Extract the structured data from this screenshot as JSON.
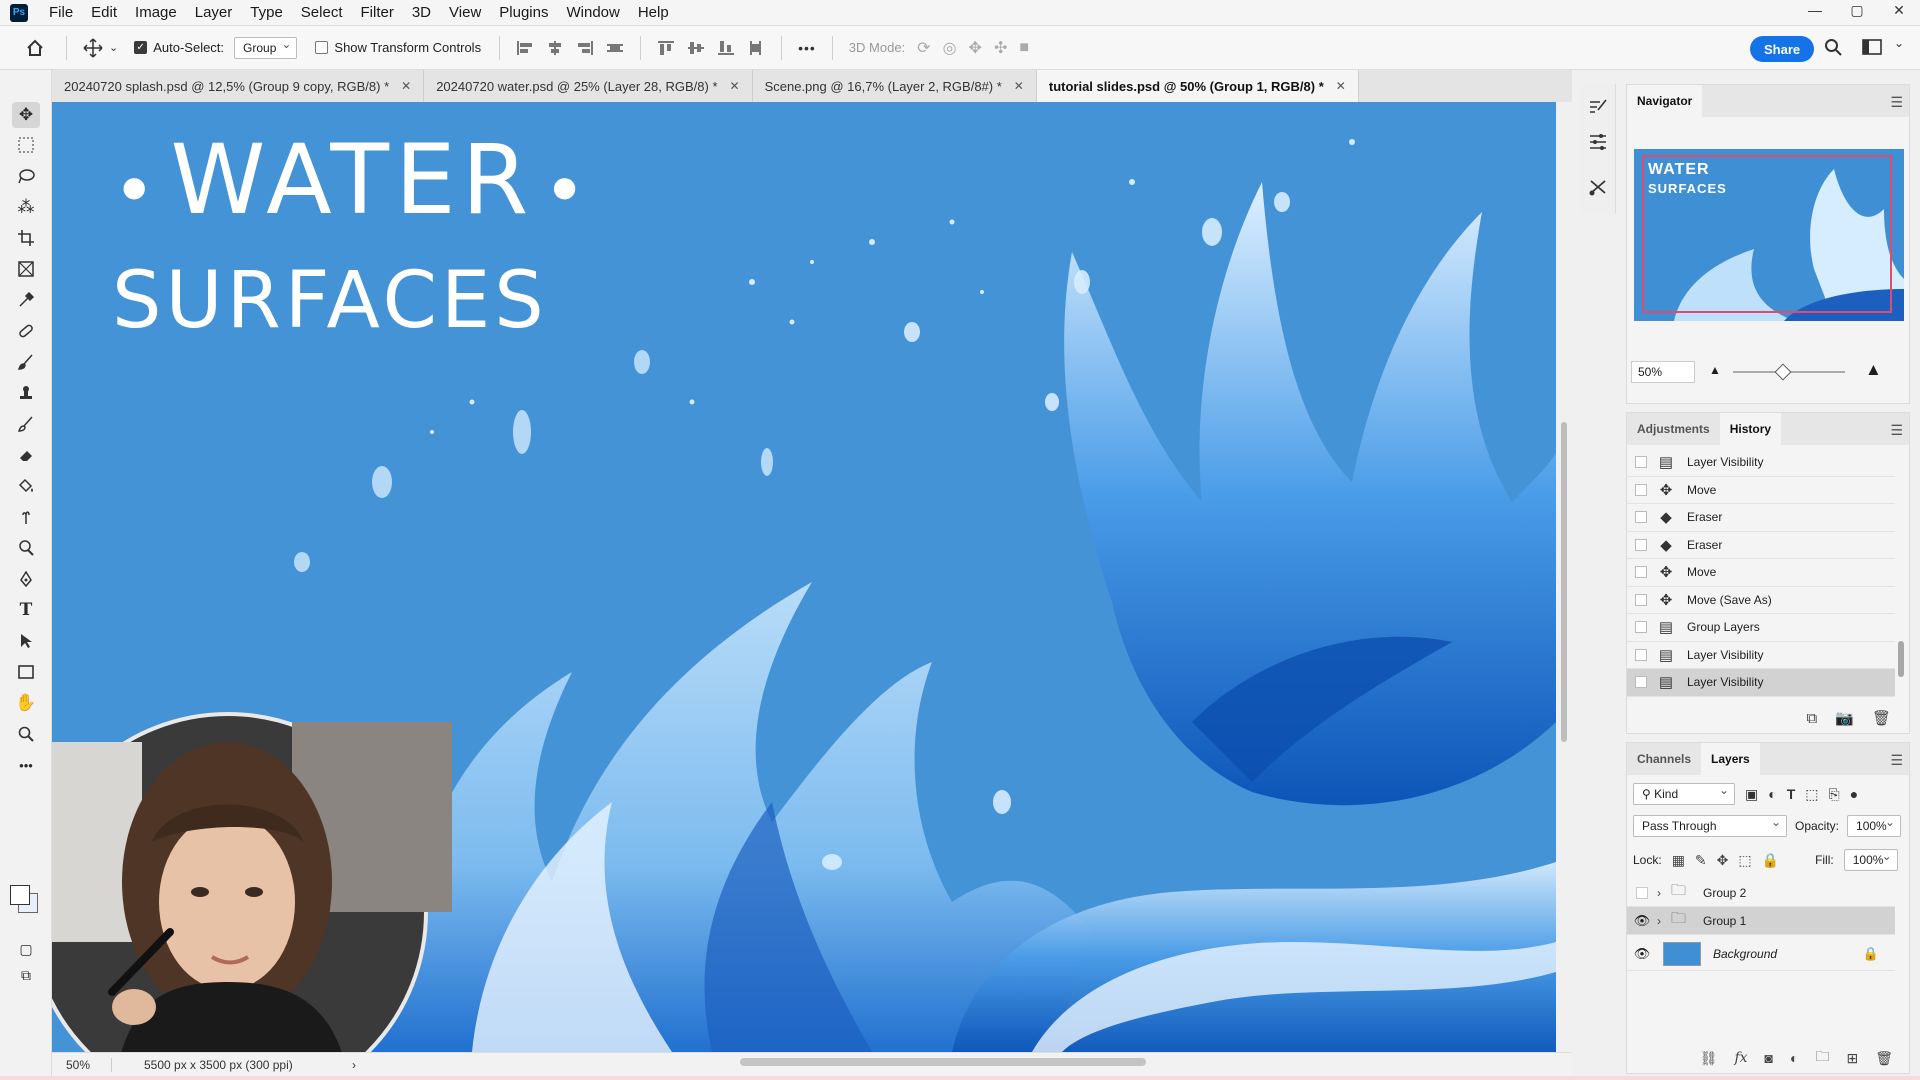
{
  "app": {
    "logo": "Ps"
  },
  "menu": [
    "File",
    "Edit",
    "Image",
    "Layer",
    "Type",
    "Select",
    "Filter",
    "3D",
    "View",
    "Plugins",
    "Window",
    "Help"
  ],
  "window_controls": {
    "minimize": "—",
    "maximize": "▢",
    "close": "✕"
  },
  "options": {
    "auto_select_label": "Auto-Select:",
    "auto_select_checked": true,
    "auto_select_value": "Group",
    "transform_label": "Show Transform Controls",
    "transform_checked": false,
    "more": "•••",
    "mode_label": "3D Mode:",
    "share": "Share"
  },
  "tabs": [
    {
      "label": "20240720 splash.psd @ 12,5% (Group 9 copy, RGB/8) *",
      "close": "✕"
    },
    {
      "label": "20240720 water.psd @ 25% (Layer 28, RGB/8) *",
      "close": "✕"
    },
    {
      "label": "Scene.png @ 16,7% (Layer 2, RGB/8#) *",
      "close": "✕"
    },
    {
      "label": "tutorial slides.psd @ 50% (Group 1, RGB/8) *",
      "close": "✕",
      "active": true
    }
  ],
  "canvas": {
    "title_line1": "WATER",
    "title_line2": "SURFACES",
    "bg_color": "#4393d6"
  },
  "status": {
    "zoom": "50%",
    "dimensions": "5500 px x 3500 px (300 ppi)",
    "arrow": "›"
  },
  "navigator": {
    "title": "Navigator",
    "thumb_line1": "WATER",
    "thumb_line2": "SURFACES",
    "zoom": "50%",
    "zoom_progress": 0.5
  },
  "history": {
    "tabs": [
      "Adjustments",
      "History"
    ],
    "active_tab": "History",
    "items": [
      {
        "label": "Layer Visibility",
        "icon": "doc-icon"
      },
      {
        "label": "Move",
        "icon": "move-icon"
      },
      {
        "label": "Eraser",
        "icon": "eraser-icon"
      },
      {
        "label": "Eraser",
        "icon": "eraser-icon"
      },
      {
        "label": "Move",
        "icon": "move-icon"
      },
      {
        "label": "Move (Save As)",
        "icon": "move-icon"
      },
      {
        "label": "Group Layers",
        "icon": "doc-icon"
      },
      {
        "label": "Layer Visibility",
        "icon": "doc-icon"
      },
      {
        "label": "Layer Visibility",
        "icon": "doc-icon",
        "selected": true
      }
    ]
  },
  "layers": {
    "tabs": [
      "Channels",
      "Layers"
    ],
    "active_tab": "Layers",
    "filter": "Kind",
    "blend_mode": "Pass Through",
    "opacity_label": "Opacity:",
    "opacity": "100%",
    "lock_label": "Lock:",
    "fill_label": "Fill:",
    "fill": "100%",
    "items": [
      {
        "name": "Group 2",
        "type": "group",
        "visible": false
      },
      {
        "name": "Group 1",
        "type": "group",
        "visible": true,
        "selected": true
      },
      {
        "name": "Background",
        "type": "pixel",
        "visible": true,
        "locked": true
      }
    ]
  }
}
